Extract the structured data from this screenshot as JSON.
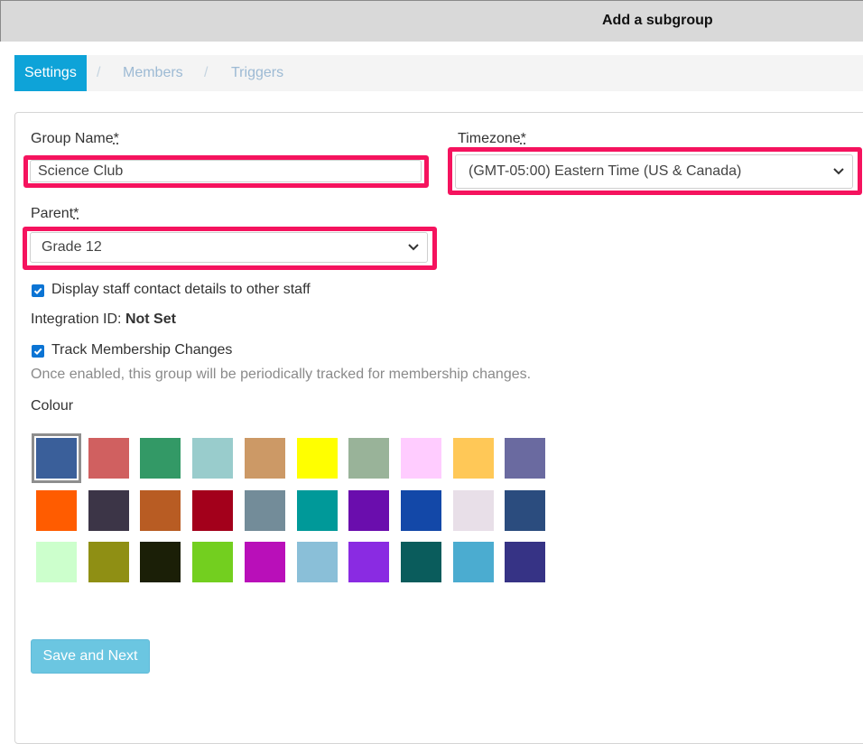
{
  "header": {
    "title": "Add a subgroup"
  },
  "tabs": {
    "settings": "Settings",
    "members": "Members",
    "triggers": "Triggers",
    "separator": "/"
  },
  "form": {
    "group_name_label": "Group Name",
    "group_name_value": "Science Club",
    "timezone_label": "Timezone",
    "timezone_value": "(GMT-05:00) Eastern Time (US & Canada)",
    "parent_label": "Parent",
    "parent_value": "Grade 12",
    "required_mark": "*",
    "display_staff_label": "Display staff contact details to other staff",
    "display_staff_checked": true,
    "integration_label": "Integration ID:",
    "integration_value": "Not Set",
    "track_label": "Track Membership Changes",
    "track_checked": true,
    "track_help": "Once enabled, this group will be periodically tracked for membership changes.",
    "colour_label": "Colour",
    "save_button": "Save and Next"
  },
  "colours": {
    "selected_index": 0,
    "swatches": [
      "#3a5f9a",
      "#d06060",
      "#339966",
      "#99cccc",
      "#cc9966",
      "#ffff00",
      "#99b399",
      "#ffccff",
      "#ffc857",
      "#6a6aa0",
      "#ff5c00",
      "#3c3547",
      "#b85c23",
      "#a3001b",
      "#738c99",
      "#009999",
      "#6a0dad",
      "#1348a8",
      "#e8dfe8",
      "#2b4c7e",
      "#ccffcc",
      "#8f8f14",
      "#1b1f07",
      "#73cf1f",
      "#b90fb9",
      "#8abfd8",
      "#8a2be2",
      "#0a5c5c",
      "#4bacd0",
      "#363385"
    ]
  },
  "highlight_color": "#f5135e",
  "accent_color": "#0ea3d8"
}
